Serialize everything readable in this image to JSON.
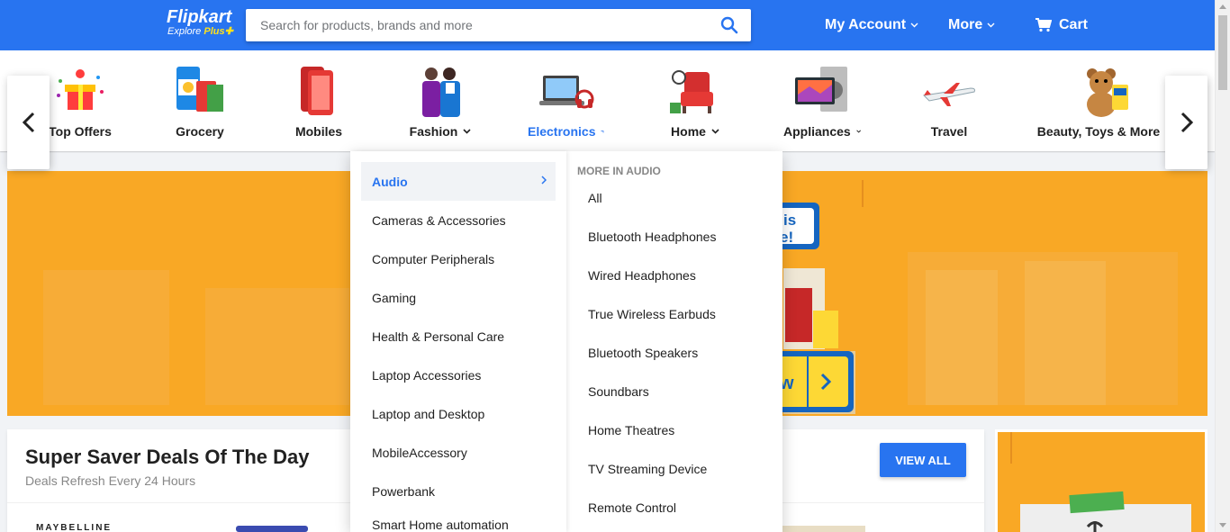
{
  "header": {
    "logo_name": "Flipkart",
    "logo_sub_prefix": "Explore ",
    "logo_sub_plus": "Plus",
    "search_placeholder": "Search for products, brands and more",
    "my_account": "My Account",
    "more": "More",
    "cart": "Cart"
  },
  "categories": [
    {
      "label": "Top Offers",
      "icon": "gift-icon"
    },
    {
      "label": "Grocery",
      "icon": "grocery-icon"
    },
    {
      "label": "Mobiles",
      "icon": "mobile-icon"
    },
    {
      "label": "Fashion",
      "icon": "fashion-icon"
    },
    {
      "label": "Electronics",
      "icon": "laptop-icon"
    },
    {
      "label": "Home",
      "icon": "armchair-icon"
    },
    {
      "label": "Appliances",
      "icon": "tv-icon"
    },
    {
      "label": "Travel",
      "icon": "airplane-icon"
    },
    {
      "label": "Beauty, Toys & More",
      "icon": "teddy-bear-icon"
    }
  ],
  "dropdown": {
    "left": [
      "Audio",
      "Cameras & Accessories",
      "Computer Peripherals",
      "Gaming",
      "Health & Personal Care",
      "Laptop Accessories",
      "Laptop and Desktop",
      "MobileAccessory",
      "Powerbank",
      "Smart Home automation"
    ],
    "right_heading": "More in Audio",
    "right": [
      "All",
      "Bluetooth Headphones",
      "Wired Headphones",
      "True Wireless Earbuds",
      "Bluetooth Speakers",
      "Soundbars",
      "Home Theatres",
      "TV Streaming Device",
      "Remote Control"
    ]
  },
  "deals": {
    "title": "Super Saver Deals Of The Day",
    "subtitle": "Deals Refresh Every 24 Hours",
    "view_all": "VIEW ALL",
    "first_brand": "MAYBELLINE"
  },
  "banner": {
    "fragment_top": "is",
    "fragment_bottom": "e!",
    "fragment_button": "w"
  },
  "colors": {
    "primary": "#2874f0",
    "banner": "#f9a825",
    "accent": "#ffe11b"
  }
}
